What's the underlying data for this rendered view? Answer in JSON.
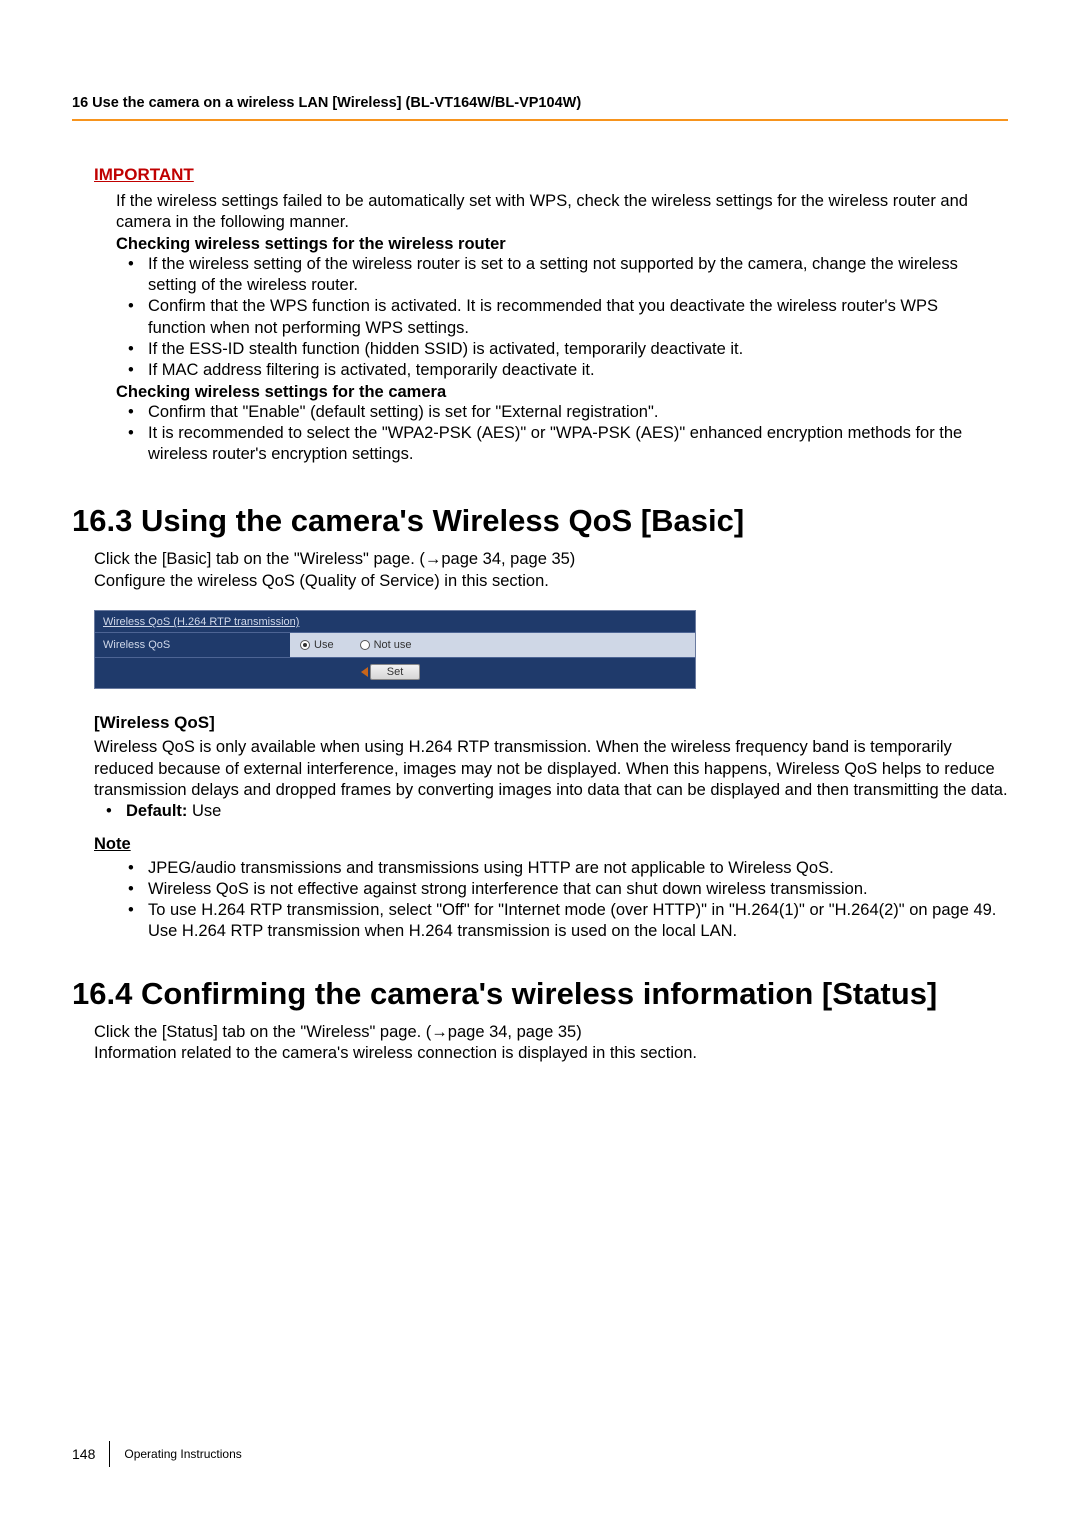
{
  "header": "16 Use the camera on a wireless LAN [Wireless] (BL-VT164W/BL-VP104W)",
  "important": {
    "label": "IMPORTANT",
    "intro": "If the wireless settings failed to be automatically set with WPS, check the wireless settings for the wireless router and camera in the following manner.",
    "check_router_heading": "Checking wireless settings for the wireless router",
    "router_items": [
      "If the wireless setting of the wireless router is set to a setting not supported by the camera, change the wireless setting of the wireless router.",
      "Confirm that the WPS function is activated. It is recommended that you deactivate the wireless router's WPS function when not performing WPS settings.",
      "If the ESS-ID stealth function (hidden SSID) is activated, temporarily deactivate it.",
      "If MAC address filtering is activated, temporarily deactivate it."
    ],
    "check_camera_heading": "Checking wireless settings for the camera",
    "camera_items": [
      "Confirm that \"Enable\" (default setting) is set for \"External registration\".",
      "It is recommended to select the \"WPA2-PSK (AES)\" or \"WPA-PSK (AES)\" enhanced encryption methods for the wireless router's encryption settings."
    ]
  },
  "section_163": {
    "heading": "16.3  Using the camera's Wireless QoS [Basic]",
    "p1": "Click the [Basic] tab on the \"Wireless\" page. (→page 34, page 35)",
    "p2": "Configure the wireless QoS (Quality of Service) in this section.",
    "ui": {
      "panel_title": "Wireless QoS (H.264 RTP transmission)",
      "row_label": "Wireless QoS",
      "opt_use": "Use",
      "opt_notuse": "Not use",
      "set_btn": "Set"
    },
    "qos_heading": "[Wireless QoS]",
    "qos_body": "Wireless QoS is only available when using H.264 RTP transmission. When the wireless frequency band is temporarily reduced because of external interference, images may not be displayed. When this happens, Wireless QoS helps to reduce transmission delays and dropped frames by converting images into data that can be displayed and then transmitting the data.",
    "default_label": "Default:",
    "default_value": " Use",
    "note_label": "Note",
    "notes": [
      "JPEG/audio transmissions and transmissions using HTTP are not applicable to Wireless QoS.",
      "Wireless QoS is not effective against strong interference that can shut down wireless transmission.",
      "To use H.264 RTP transmission, select \"Off\" for \"Internet mode (over HTTP)\" in \"H.264(1)\" or \"H.264(2)\" on page 49. Use H.264 RTP transmission when H.264 transmission is used on the local LAN."
    ]
  },
  "section_164": {
    "heading": "16.4  Confirming the camera's wireless information [Status]",
    "p1": "Click the [Status] tab on the \"Wireless\" page. (→page 34, page 35)",
    "p2": "Information related to the camera's wireless connection is displayed in this section."
  },
  "footer": {
    "page": "148",
    "doc": "Operating Instructions"
  }
}
